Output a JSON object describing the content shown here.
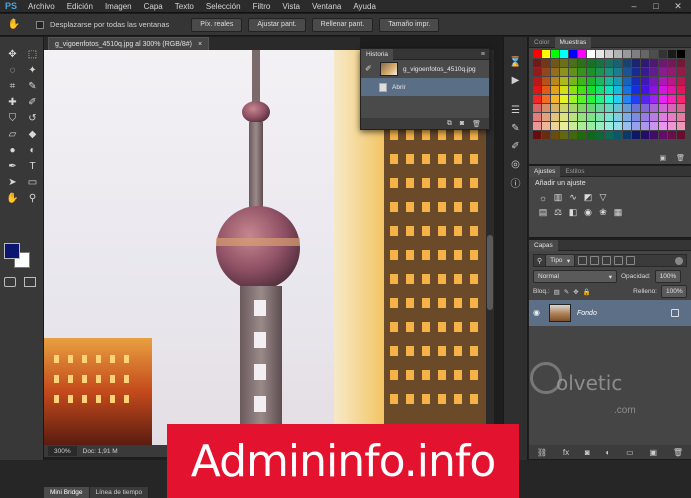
{
  "app": {
    "logo": "PS"
  },
  "menu": [
    "Archivo",
    "Edición",
    "Imagen",
    "Capa",
    "Texto",
    "Selección",
    "Filtro",
    "Vista",
    "Ventana",
    "Ayuda"
  ],
  "window_controls": {
    "minimize": "–",
    "maximize": "□",
    "close": "✕"
  },
  "options_bar": {
    "scroll_all_label": "Desplazarse por todas las ventanas",
    "buttons": [
      "Píx. reales",
      "Ajustar pant.",
      "Rellenar pant.",
      "Tamaño impr."
    ]
  },
  "document": {
    "tab_title": "g_vigoenfotos_4510q.jpg al 300% (RGB/8#)",
    "close": "×",
    "zoom": "300%",
    "doc_size": "Doc: 1,91 M"
  },
  "history_panel": {
    "tab": "Historia",
    "menu": "≡",
    "snapshot_name": "g_vigoenfotos_4510q.jpg",
    "steps": [
      "Abrir"
    ]
  },
  "color_panel": {
    "tabs": [
      "Color",
      "Muestras"
    ]
  },
  "adjustments_panel": {
    "tabs": [
      "Ajustes",
      "Estilos"
    ],
    "title": "Añadir un ajuste",
    "row1_icons": [
      "brightness-icon",
      "levels-icon",
      "curves-icon",
      "exposure-icon",
      "vibrance-icon"
    ],
    "row2_icons": [
      "hue-icon",
      "balance-icon",
      "bw-icon",
      "photo-filter-icon",
      "channel-mixer-icon",
      "lookup-icon"
    ]
  },
  "layers_panel": {
    "tab": "Capas",
    "filter_label": "Tipo",
    "blend_mode": "Normal",
    "opacity_label": "Opacidad:",
    "opacity_value": "100%",
    "lock_label": "Bloq.:",
    "fill_label": "Relleno:",
    "fill_value": "100%",
    "layers": [
      {
        "name": "Fondo"
      }
    ]
  },
  "bottom_tabs": [
    "Mini Bridge",
    "Línea de tiempo"
  ],
  "watermark": {
    "text": "olvetic",
    "suffix": ".com"
  },
  "banner": {
    "text": "Admininfo.info",
    "color": "#e3132f"
  },
  "colors": {
    "foreground": "#0c1570",
    "background": "#ffffff"
  }
}
